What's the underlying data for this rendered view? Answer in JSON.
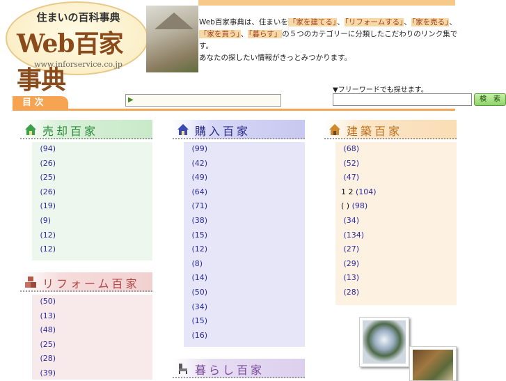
{
  "header": {
    "logo_tagline": "住まいの百科事典",
    "logo_title": "Web百家事典",
    "logo_url": "www.inforservice.co.jp",
    "intro_prefix": "Web百家事典は、住まいを",
    "intro_kw1": "「家を建てる」",
    "intro_sep1": "、",
    "intro_kw2": "「リフォームする」",
    "intro_sep2": "、",
    "intro_kw3": "「家を売る」",
    "intro_sep3": "、",
    "intro_kw4": "「家を買う」",
    "intro_sep4": "、",
    "intro_kw5": "「暮らす」",
    "intro_mid": "の５つのカテゴリーに分類したこだわりのリンク集です。",
    "intro_line3": "あなたの探したい情報がきっとみつかります。"
  },
  "glyph": "",
  "toc": {
    "tab_label": "目 次",
    "marquee_arrow": "▶",
    "marquee_text": ""
  },
  "search": {
    "label": "▼フリーワードでも探せます。",
    "placeholder": "",
    "button_label": "検　索"
  },
  "categories": {
    "sell": {
      "title": "売却百家",
      "items": [
        {
          "label": "",
          "count": "(94)"
        },
        {
          "label": "",
          "count": "(26)"
        },
        {
          "label": "",
          "count": "(25)"
        },
        {
          "label": "",
          "count": "(26)"
        },
        {
          "label": "",
          "count": "(19)"
        },
        {
          "label": "",
          "count": "(9)"
        },
        {
          "label": "",
          "count": "(12)"
        },
        {
          "label": "",
          "count": "(12)"
        }
      ]
    },
    "buy": {
      "title": "購入百家",
      "items": [
        {
          "label": "",
          "count": "(99)"
        },
        {
          "label": "",
          "count": "(42)"
        },
        {
          "label": "",
          "count": "(49)"
        },
        {
          "label": "",
          "count": "(64)"
        },
        {
          "label": "",
          "count": "(71)"
        },
        {
          "label": "",
          "count": "(38)"
        },
        {
          "label": "",
          "count": "(15)"
        },
        {
          "label": "",
          "count": "(12)"
        },
        {
          "label": "",
          "count": "(8)"
        },
        {
          "label": "",
          "count": "(14)"
        },
        {
          "label": "",
          "count": "(50)"
        },
        {
          "label": "",
          "count": "(34)"
        },
        {
          "label": "",
          "count": "(15)"
        },
        {
          "label": "",
          "count": "(16)"
        }
      ]
    },
    "build": {
      "title": "建築百家",
      "items": [
        {
          "label": "",
          "count": "(68)"
        },
        {
          "label": "",
          "count": "(52)"
        },
        {
          "label": "",
          "count": "(47)"
        },
        {
          "label": "1 2",
          "count": "(104)"
        },
        {
          "label": "( )",
          "count": "(98)"
        },
        {
          "label": "",
          "count": "(34)"
        },
        {
          "label": "",
          "count": "(134)"
        },
        {
          "label": "",
          "count": "(27)"
        },
        {
          "label": "",
          "count": "(29)"
        },
        {
          "label": "",
          "count": "(13)"
        },
        {
          "label": "",
          "count": "(28)"
        }
      ]
    },
    "reform": {
      "title": "リフォーム百家",
      "items": [
        {
          "label": "",
          "count": "(50)"
        },
        {
          "label": "",
          "count": "(13)"
        },
        {
          "label": "",
          "count": "(48)"
        },
        {
          "label": "",
          "count": "(25)"
        },
        {
          "label": "",
          "count": "(28)"
        },
        {
          "label": "",
          "count": "(39)"
        }
      ]
    },
    "life": {
      "title": "暮らし百家"
    }
  },
  "colors": {
    "accent_orange": "#f6a451",
    "sell_green": "#2a8a3a",
    "buy_blue": "#2a2a8a",
    "build_orange": "#c0701a",
    "reform_pink": "#b04848",
    "life_purple": "#7a4a9a"
  }
}
